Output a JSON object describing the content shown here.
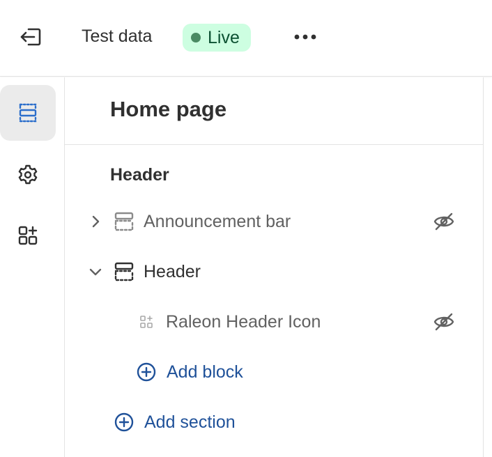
{
  "topbar": {
    "exit_icon": "exit-icon",
    "theme_name": "Test data",
    "status_label": "Live",
    "status_color": "#cdfee1",
    "more_icon": "more-horizontal-icon"
  },
  "rail": {
    "items": [
      {
        "icon": "sections-icon",
        "active": true
      },
      {
        "icon": "gear-icon",
        "active": false
      },
      {
        "icon": "apps-add-icon",
        "active": false
      }
    ]
  },
  "panel": {
    "title": "Home page",
    "group_label": "Header",
    "sections": [
      {
        "label": "Announcement bar",
        "expanded": false,
        "hidden": true
      },
      {
        "label": "Header",
        "expanded": true,
        "hidden": false,
        "blocks": [
          {
            "label": "Raleon Header Icon",
            "hidden": true
          }
        ],
        "add_block_label": "Add block"
      }
    ],
    "add_section_label": "Add section"
  },
  "colors": {
    "accent": "#1f5199",
    "rail_active_bg": "#ebebeb",
    "muted_text": "#616161"
  }
}
